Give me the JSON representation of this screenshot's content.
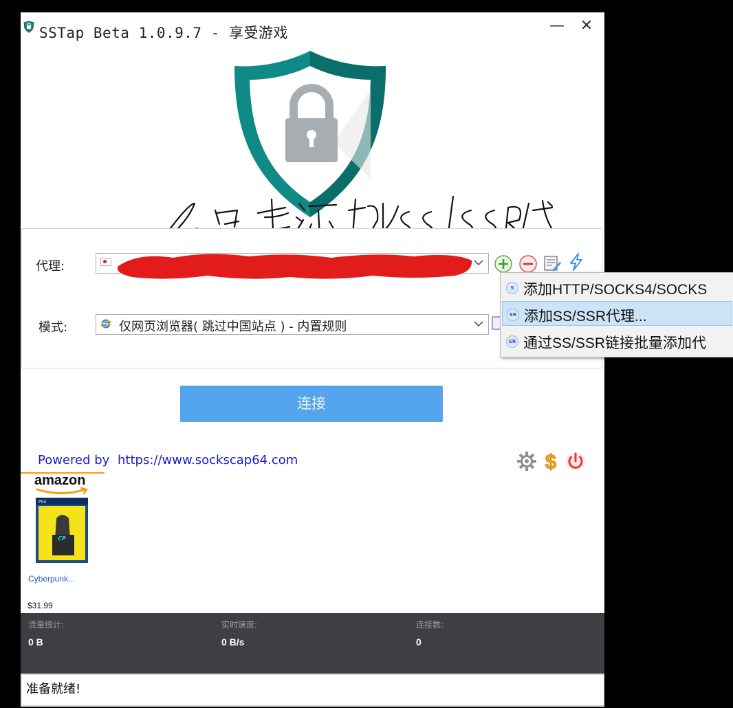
{
  "window": {
    "title": "SSTap Beta 1.0.9.7 - 享受游戏",
    "minimize_glyph": "—",
    "close_glyph": "✕"
  },
  "annotation": {
    "handwritten_text": "2.点击添加SS/SSR代理。"
  },
  "config": {
    "proxy_label": "代理:",
    "proxy_value": "",
    "mode_label": "模式:",
    "mode_value": "仅网页浏览器( 跳过中国站点 ) - 内置规则"
  },
  "toolbar": {
    "icons": [
      "add-icon",
      "remove-icon",
      "edit-icon",
      "flash-icon"
    ]
  },
  "connect": {
    "label": "连接"
  },
  "footer": {
    "powered_prefix": "Powered by",
    "powered_link": "https://www.sockscap64.com",
    "icons": [
      "gear-icon",
      "dollar-icon",
      "power-icon"
    ]
  },
  "ad": {
    "brand": "amazon",
    "product_title": "Cyberpunk...",
    "price": "$31.99"
  },
  "stats": [
    {
      "label": "流量统计:",
      "value": "0 B"
    },
    {
      "label": "实时速度:",
      "value": "0 B/s"
    },
    {
      "label": "连接数:",
      "value": "0"
    }
  ],
  "status": {
    "text": "准备就绪!"
  },
  "context_menu": {
    "items": [
      {
        "icon": "S",
        "label": "添加HTTP/SOCKS4/SOCKS"
      },
      {
        "icon": "SR",
        "label": "添加SS/SSR代理..."
      },
      {
        "icon": "SR",
        "label": "通过SS/SSR链接批量添加代"
      }
    ],
    "highlighted_index": 1
  },
  "colors": {
    "connect_button": "#55a4ee",
    "shield_teal": "#0f8a86",
    "redaction_red": "#e21b1b",
    "stats_background": "#3d3f42",
    "link_blue": "#1a1ac8",
    "menu_highlight": "#cce4f7"
  }
}
